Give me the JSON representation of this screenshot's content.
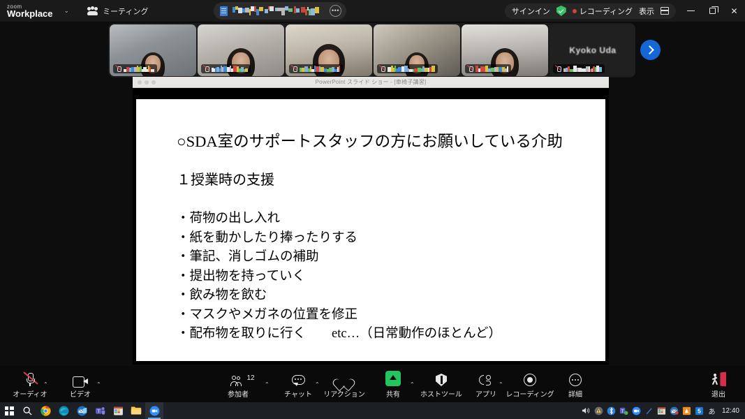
{
  "app": {
    "brand_small": "zoom",
    "brand_big": "Workplace",
    "brand_caret": "⌄",
    "meeting_tab": "ミーティング",
    "meeting_tab_icon": "people-group-icon"
  },
  "titlebar": {
    "center_pill": {
      "doc_icon": "document-icon",
      "title_blurred": true,
      "more_label": "•••",
      "more_icon": "more-options-icon"
    },
    "sign_in": "サインイン",
    "security_icon": "shield-check-icon",
    "recording_label": "レコーディング",
    "recording_dot_color": "#e03b3b",
    "view_label": "表示",
    "view_icon": "layout-grid-icon",
    "minimize": "minimize-icon",
    "maximize": "restore-icon",
    "close": "close-icon"
  },
  "filmstrip": {
    "next_arrow_icon": "chevron-right-icon",
    "active_border_color": "#2fe07f",
    "tiles": [
      {
        "id": 1,
        "name_blurred": true,
        "muted": true,
        "video_on": true,
        "active": false
      },
      {
        "id": 2,
        "name_blurred": true,
        "muted": true,
        "video_on": true,
        "active": false
      },
      {
        "id": 3,
        "name_blurred": true,
        "muted": true,
        "video_on": true,
        "active": true
      },
      {
        "id": 4,
        "name_blurred": true,
        "muted": true,
        "video_on": true,
        "active": false
      },
      {
        "id": 5,
        "name_blurred": true,
        "muted": true,
        "video_on": true,
        "active": false
      },
      {
        "id": 6,
        "name": "Kyoko Uda",
        "name_blurred": true,
        "muted": true,
        "video_on": false,
        "active": false
      }
    ]
  },
  "shared_screen": {
    "window_title": "PowerPoint スライド ショー - [車椅子講習]",
    "traffic_lights": [
      "close-dot",
      "minimize-dot",
      "maximize-dot"
    ],
    "slide": {
      "heading": "○SDA室のサポートスタッフの方にお願いしている介助",
      "subheading": "１授業時の支援",
      "bullets": [
        "・荷物の出し入れ",
        "・紙を動かしたり捧ったりする",
        "・筆記、消しゴムの補助",
        "・提出物を持っていく",
        "・飲み物を飲む",
        "・マスクやメガネの位置を修正",
        "・配布物を取りに行く　　etc…（日常動作のほとんど）"
      ]
    }
  },
  "toolbar": {
    "audio": {
      "label": "オーディオ",
      "icon": "microphone-muted-icon",
      "muted": true,
      "caret": "⌃"
    },
    "video": {
      "label": "ビデオ",
      "icon": "camera-icon",
      "caret": "⌃"
    },
    "participants": {
      "label": "参加者",
      "icon": "participants-icon",
      "count": "12",
      "caret": "⌃"
    },
    "chat": {
      "label": "チャット",
      "icon": "chat-bubble-icon",
      "caret": "⌃"
    },
    "reactions": {
      "label": "リアクション",
      "icon": "heart-icon"
    },
    "share": {
      "label": "共有",
      "icon": "share-screen-icon",
      "color": "#22c55e",
      "caret": "⌃"
    },
    "host_tools": {
      "label": "ホストツール",
      "icon": "shield-icon"
    },
    "apps": {
      "label": "アプリ",
      "icon": "apps-icon",
      "caret": "⌃"
    },
    "recording": {
      "label": "レコーディング",
      "icon": "record-circle-icon"
    },
    "more": {
      "label": "詳細",
      "icon": "more-horizontal-icon"
    },
    "leave": {
      "label": "退出",
      "icon": "leave-meeting-icon",
      "color": "#d32f4a"
    }
  },
  "taskbar": {
    "start_icon": "windows-start-icon",
    "search_icon": "search-icon",
    "pinned": [
      {
        "name": "chrome-icon",
        "color": "#f4b400"
      },
      {
        "name": "edge-icon",
        "color": "#0f8bc4"
      },
      {
        "name": "mail-icon",
        "color": "#1b74c8"
      },
      {
        "name": "teams-icon",
        "color": "#5b5fc7"
      },
      {
        "name": "excel-icon",
        "color": "#1d7a45"
      },
      {
        "name": "file-explorer-icon",
        "color": "#f6c453"
      },
      {
        "name": "zoom-icon",
        "color": "#2d8cff"
      }
    ],
    "tray": [
      {
        "name": "volume-icon",
        "glyph": "🔊"
      },
      {
        "name": "warning-icon",
        "glyph": "⚠"
      },
      {
        "name": "bluetooth-icon",
        "glyph": "Ƀ"
      },
      {
        "name": "teams-tray-icon",
        "glyph": "T"
      },
      {
        "name": "zoom-tray-icon",
        "glyph": "zm"
      },
      {
        "name": "onedrive-icon",
        "glyph": "/"
      },
      {
        "name": "excel-tray-icon",
        "glyph": "X"
      },
      {
        "name": "mail-tray-icon",
        "glyph": "✉"
      },
      {
        "name": "orange-app-icon",
        "glyph": "✚"
      },
      {
        "name": "security-app-icon",
        "glyph": "S"
      },
      {
        "name": "ime-icon",
        "glyph": "あ"
      }
    ],
    "clock": "12:40"
  }
}
